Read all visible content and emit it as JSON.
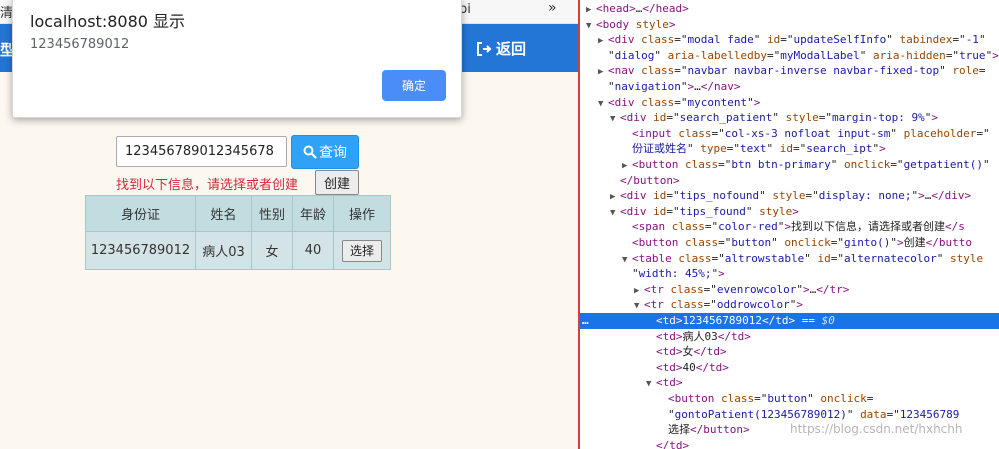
{
  "browser": {
    "tab_left_fragment": "清",
    "tab_right_fragment": "pi",
    "more_tabs": "»"
  },
  "navbar": {
    "brand_fragment": "型",
    "back_label": "返回",
    "color": "#2376d6"
  },
  "alert": {
    "title": "localhost:8080 显示",
    "message": "123456789012",
    "ok_label": "确定"
  },
  "search": {
    "input_value": "123456789012345678",
    "button_label": "查询",
    "button_icon": "search-icon"
  },
  "tips_found": {
    "message": "找到以下信息，请选择或者创建",
    "create_label": "创建"
  },
  "table": {
    "headers": [
      "身份证",
      "姓名",
      "性别",
      "年龄",
      "操作"
    ],
    "rows": [
      {
        "id": "123456789012",
        "name": "病人03",
        "gender": "女",
        "age": "40",
        "action": "选择"
      }
    ]
  },
  "devtools": {
    "lines": [
      {
        "arrow": "▶",
        "indent": 1,
        "html": "<span class='tag'>&lt;head&gt;</span>…<span class='tag'>&lt;/head&gt;</span>"
      },
      {
        "arrow": "▼",
        "indent": 1,
        "html": "<span class='tag'>&lt;body</span> <span class='attr'>style</span><span class='tag'>&gt;</span>"
      },
      {
        "arrow": "▶",
        "indent": 2,
        "html": "<span class='tag'>&lt;div</span> <span class='attr'>class</span>=\"<span class='val'>modal fade</span>\" <span class='attr'>id</span>=\"<span class='val'>updateSelfInfo</span>\" <span class='attr'>tabindex</span>=\"<span class='val'>-1</span>\""
      },
      {
        "arrow": "",
        "indent": 2,
        "html": "\"<span class='val'>dialog</span>\" <span class='attr'>aria-labelledby</span>=\"<span class='val'>myModalLabel</span>\" <span class='attr'>aria-hidden</span>=\"<span class='val'>true</span>\"<span class='tag'>&gt;</span>…"
      },
      {
        "arrow": "▶",
        "indent": 2,
        "html": "<span class='tag'>&lt;nav</span> <span class='attr'>class</span>=\"<span class='val'>navbar navbar-inverse navbar-fixed-top</span>\" <span class='attr'>role</span>="
      },
      {
        "arrow": "",
        "indent": 2,
        "html": "\"<span class='val'>navigation</span>\"<span class='tag'>&gt;</span>…<span class='tag'>&lt;/nav&gt;</span>"
      },
      {
        "arrow": "▼",
        "indent": 2,
        "html": "<span class='tag'>&lt;div</span> <span class='attr'>class</span>=\"<span class='val'>mycontent</span>\"<span class='tag'>&gt;</span>"
      },
      {
        "arrow": "▼",
        "indent": 3,
        "html": "<span class='tag'>&lt;div</span> <span class='attr'>id</span>=\"<span class='val'>search_patient</span>\" <span class='attr'>style</span>=\"<span class='val'>margin-top: 9%</span>\"<span class='tag'>&gt;</span>"
      },
      {
        "arrow": "",
        "indent": 4,
        "html": "<span class='tag'>&lt;input</span> <span class='attr'>class</span>=\"<span class='val'>col-xs-3 nofloat input-sm</span>\" <span class='attr'>placeholder</span>=\""
      },
      {
        "arrow": "",
        "indent": 4,
        "html": "<span class='val'>份证或姓名</span>\" <span class='attr'>type</span>=\"<span class='val'>text</span>\" <span class='attr'>id</span>=\"<span class='val'>search_ipt</span>\"<span class='tag'>&gt;</span>"
      },
      {
        "arrow": "▶",
        "indent": 4,
        "html": "<span class='tag'>&lt;button</span> <span class='attr'>class</span>=\"<span class='val'>btn btn-primary</span>\" <span class='attr'>onclick</span>=\"<span class='val'>getpatient()</span>\""
      },
      {
        "arrow": "",
        "indent": 3,
        "html": "<span class='tag'>&lt;/button&gt;</span>"
      },
      {
        "arrow": "▶",
        "indent": 3,
        "html": "<span class='tag'>&lt;div</span> <span class='attr'>id</span>=\"<span class='val'>tips_nofound</span>\" <span class='attr'>style</span>=\"<span class='val'>display: none;</span>\"<span class='tag'>&gt;</span>…<span class='tag'>&lt;/div&gt;</span>"
      },
      {
        "arrow": "▼",
        "indent": 3,
        "html": "<span class='tag'>&lt;div</span> <span class='attr'>id</span>=\"<span class='val'>tips_found</span>\" <span class='attr'>style</span><span class='tag'>&gt;</span>"
      },
      {
        "arrow": "",
        "indent": 4,
        "html": "<span class='tag'>&lt;span</span> <span class='attr'>class</span>=\"<span class='val'>color-red</span>\"<span class='tag'>&gt;</span><span class='txt'>找到以下信息，请选择或者创建</span><span class='tag'>&lt;/s</span>"
      },
      {
        "arrow": "",
        "indent": 4,
        "html": "<span class='tag'>&lt;button</span> <span class='attr'>class</span>=\"<span class='val'>button</span>\" <span class='attr'>onclick</span>=\"<span class='val'>ginto()</span>\"<span class='tag'>&gt;</span><span class='txt'>创建</span><span class='tag'>&lt;/butto</span>"
      },
      {
        "arrow": "▼",
        "indent": 4,
        "html": "<span class='tag'>&lt;table</span> <span class='attr'>class</span>=\"<span class='val'>altrowstable</span>\" <span class='attr'>id</span>=\"<span class='val'>alternatecolor</span>\" <span class='attr'>style</span>"
      },
      {
        "arrow": "",
        "indent": 4,
        "html": "\"<span class='val'>width: 45%;</span>\"<span class='tag'>&gt;</span>"
      },
      {
        "arrow": "▶",
        "indent": 5,
        "html": "<span class='tag'>&lt;tr</span> <span class='attr'>class</span>=\"<span class='val'>evenrowcolor</span>\"<span class='tag'>&gt;</span>…<span class='tag'>&lt;/tr&gt;</span>"
      },
      {
        "arrow": "▼",
        "indent": 5,
        "html": "<span class='tag'>&lt;tr</span> <span class='attr'>class</span>=\"<span class='val'>oddrowcolor</span>\"<span class='tag'>&gt;</span>"
      },
      {
        "arrow": "",
        "indent": 6,
        "sel": true,
        "html": "<span class='tag'>&lt;td&gt;</span><span class='txt'>123456789012</span><span class='tag'>&lt;/td&gt;</span> == <span class='dollar'>$0</span>"
      },
      {
        "arrow": "",
        "indent": 6,
        "html": "<span class='tag'>&lt;td&gt;</span><span class='txt'>病人03</span><span class='tag'>&lt;/td&gt;</span>"
      },
      {
        "arrow": "",
        "indent": 6,
        "html": "<span class='tag'>&lt;td&gt;</span><span class='txt'>女</span><span class='tag'>&lt;/td&gt;</span>"
      },
      {
        "arrow": "",
        "indent": 6,
        "html": "<span class='tag'>&lt;td&gt;</span><span class='txt'>40</span><span class='tag'>&lt;/td&gt;</span>"
      },
      {
        "arrow": "▼",
        "indent": 6,
        "html": "<span class='tag'>&lt;td&gt;</span>"
      },
      {
        "arrow": "",
        "indent": 7,
        "html": "<span class='tag'>&lt;button</span> <span class='attr'>class</span>=\"<span class='val'>button</span>\" <span class='attr'>onclick</span>="
      },
      {
        "arrow": "",
        "indent": 7,
        "html": "\"<span class='val'>gontoPatient(123456789012)</span>\" <span class='attr'>data</span>=\"<span class='val'>123456789</span>"
      },
      {
        "arrow": "",
        "indent": 7,
        "html": "<span class='txt'>选择</span><span class='tag'>&lt;/button&gt;</span>"
      },
      {
        "arrow": "",
        "indent": 6,
        "html": "<span class='tag'>&lt;/td&gt;</span>"
      }
    ],
    "selected_marker": "…",
    "watermark": "https://blog.csdn.net/hxhchh"
  }
}
